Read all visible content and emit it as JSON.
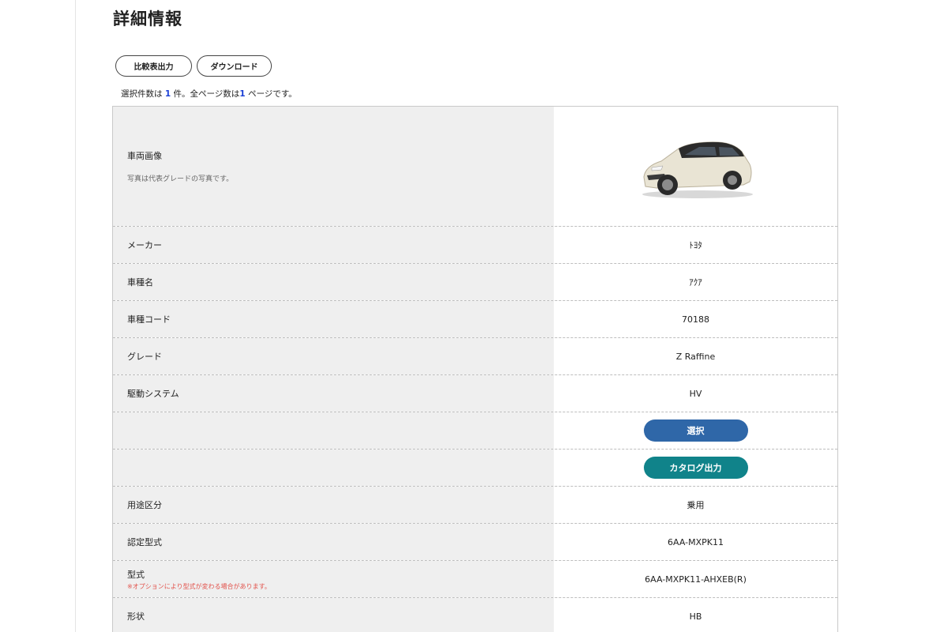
{
  "page": {
    "title": "詳細情報"
  },
  "toolbar": {
    "compare_label": "比較表出力",
    "download_label": "ダウンロード"
  },
  "count": {
    "prefix": "選択件数は ",
    "selected": "1",
    "middle": " 件。全ページ数は",
    "pages": "1",
    "suffix": " ページです。"
  },
  "rows": {
    "image": {
      "label": "車両画像",
      "note": "写真は代表グレードの写真です。"
    },
    "maker": {
      "label": "メーカー",
      "value": "ﾄﾖﾀ"
    },
    "model": {
      "label": "車種名",
      "value": "ｱｸｱ"
    },
    "model_code": {
      "label": "車種コード",
      "value": "70188"
    },
    "grade": {
      "label": "グレード",
      "value": "Z Raffine"
    },
    "drive": {
      "label": "駆動システム",
      "value": "HV"
    },
    "select_button": "選択",
    "catalog_button": "カタログ出力",
    "usage": {
      "label": "用途区分",
      "value": "乗用"
    },
    "cert_type": {
      "label": "認定型式",
      "value": "6AA-MXPK11"
    },
    "type": {
      "label": "型式",
      "note": "※オプションにより型式が変わる場合があります。",
      "value": "6AA-MXPK11-AHXEB(R)"
    },
    "shape": {
      "label": "形状",
      "value": "HB"
    }
  },
  "colors": {
    "accent_select": "#2f67a8",
    "accent_catalog": "#10838a",
    "warning": "#e2524b",
    "count_number": "#1a3fd6"
  }
}
